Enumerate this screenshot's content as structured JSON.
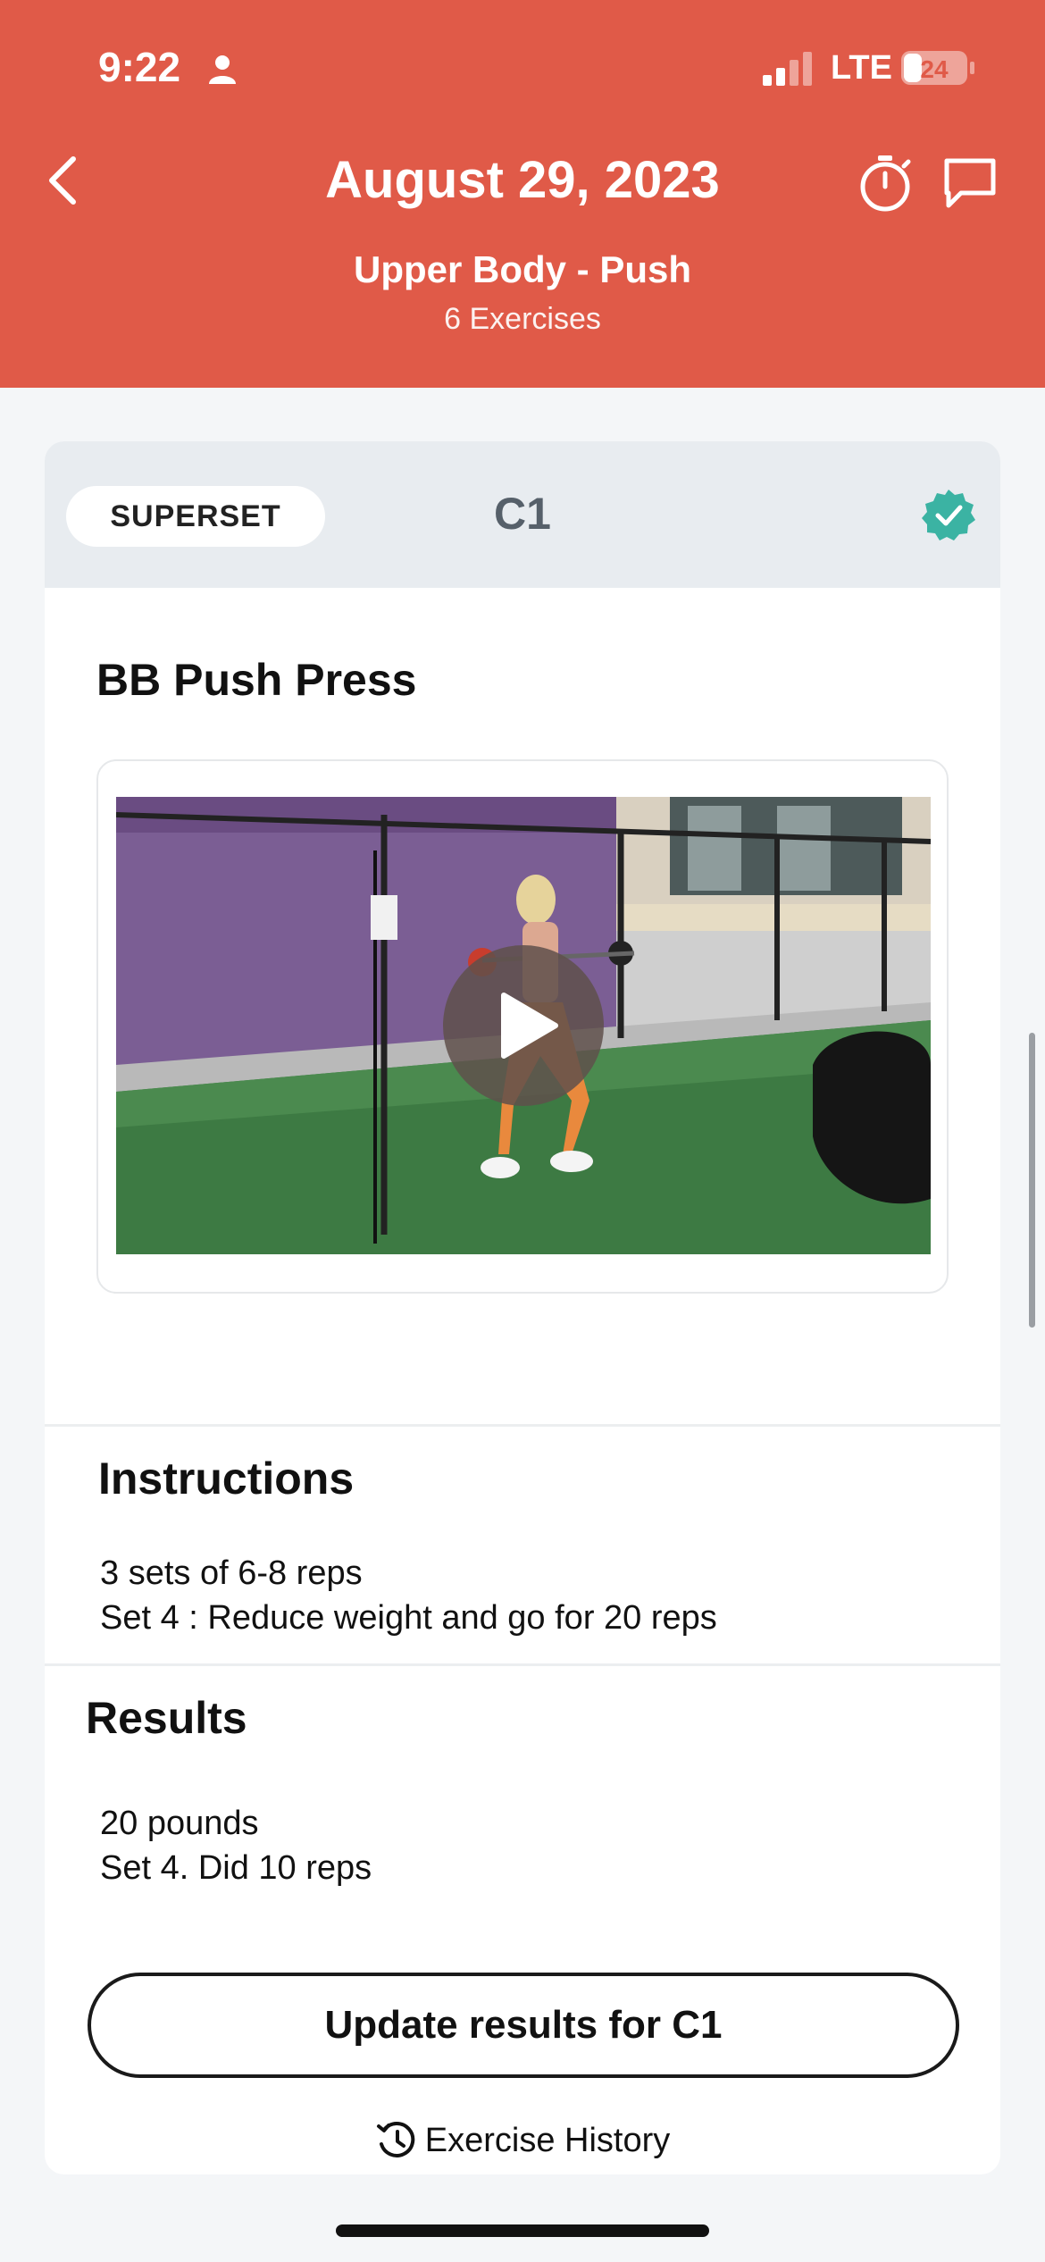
{
  "status_bar": {
    "time": "9:22",
    "network": "LTE",
    "battery": "24"
  },
  "header": {
    "title": "August 29, 2023",
    "workout_name": "Upper Body - Push",
    "exercise_count": "6 Exercises",
    "background_color": "#e05a48"
  },
  "group": {
    "badge": "SUPERSET",
    "label": "C1",
    "completed_color": "#3bb3a3"
  },
  "exercise": {
    "name": "BB Push Press"
  },
  "instructions": {
    "heading": "Instructions",
    "lines": [
      "3 sets of 6-8 reps",
      "Set 4 : Reduce weight and go for 20 reps"
    ]
  },
  "results": {
    "heading": "Results",
    "lines": [
      "20 pounds",
      "Set 4. Did 10 reps"
    ]
  },
  "actions": {
    "update_button": "Update results for C1",
    "history_link": "Exercise History"
  }
}
